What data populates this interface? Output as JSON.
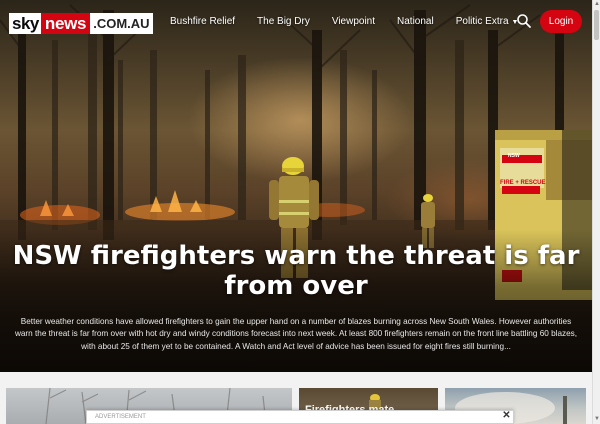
{
  "logo": {
    "sky": "sky",
    "news": "news",
    "domain": ".COM.AU"
  },
  "nav": {
    "links": [
      "Bushfire Relief",
      "The Big Dry",
      "Viewpoint",
      "National",
      "Politic Extra"
    ],
    "login_label": "Login"
  },
  "hero": {
    "headline": "NSW firefighters warn the threat is far from over",
    "summary": "Better weather conditions have allowed firefighters to gain the upper hand on a number of blazes burning across New South Wales. However authorities warn the threat is far from over with hot dry and windy conditions forecast into next week. At least 800 firefighters remain on the front line battling 60 blazes, with about 25 of them yet to be contained. A Watch and Act level of advice has been issued for eight fires still burning...",
    "truck_sign_1": "FIRE + RESCUE",
    "truck_sign_2": "NSW"
  },
  "cards": {
    "card2_text": "Firefighters mate",
    "card3_text": ""
  },
  "ad": {
    "label": "Advertisement",
    "close": "✕"
  },
  "colors": {
    "brand_red": "#d40511"
  }
}
